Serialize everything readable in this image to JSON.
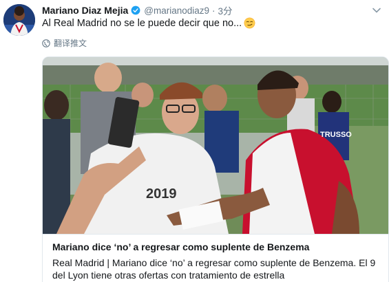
{
  "author": {
    "name": "Mariano Diaz Mejia",
    "handle": "@marianodiaz9",
    "time": "3分",
    "verified": true
  },
  "tweet": {
    "text": "Al Real Madrid no se le puede decir que no...",
    "emoji": "smirk-face-icon"
  },
  "translate_label": "翻译推文",
  "card": {
    "title": "Mariano dice ‘no’ a regresar como suplente de Benzema",
    "description": "Real Madrid | Mariano dice ‘no’ a regresar como suplente de Benzema. El 9 del Lyon tiene otras ofertas con tratamiento de estrella",
    "jersey_text": "TRUSSO"
  },
  "colors": {
    "verified": "#1da1f2",
    "secondary_text": "#657786",
    "shirt_red": "#c8102e"
  }
}
